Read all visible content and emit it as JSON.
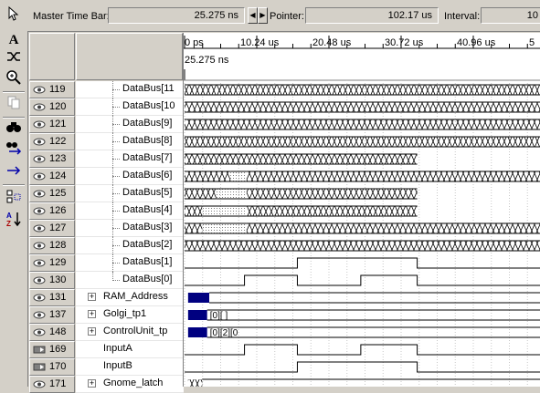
{
  "topbar": {
    "master_label": "Master Time Bar:",
    "master_value": "25.275 ns",
    "pointer_label": "Pointer:",
    "pointer_value": "102.17 us",
    "interval_label": "Interval:",
    "interval_value": "10"
  },
  "timeline": {
    "ticks": [
      "0 ps",
      "10.24 us",
      "20.48 us",
      "30.72 us",
      "40.96 us",
      "5"
    ],
    "cursor_label": "25.275 ns"
  },
  "toolbar": {
    "tools": [
      "select-arrow-icon",
      "text-tool-icon",
      "waveform-edit-icon",
      "zoom-icon",
      "copy-icon",
      "find-icon",
      "find-next-icon",
      "goto-icon",
      "group-icon",
      "sort-icon"
    ]
  },
  "rows": [
    {
      "id": "119",
      "name": "DataBus[11",
      "type": "child",
      "dir": "out",
      "wave": "bus"
    },
    {
      "id": "120",
      "name": "DataBus[10",
      "type": "child",
      "dir": "out",
      "wave": "bus"
    },
    {
      "id": "121",
      "name": "DataBus[9]",
      "type": "child",
      "dir": "out",
      "wave": "bus"
    },
    {
      "id": "122",
      "name": "DataBus[8]",
      "type": "child",
      "dir": "out",
      "wave": "bus"
    },
    {
      "id": "123",
      "name": "DataBus[7]",
      "type": "child",
      "dir": "out",
      "wave": "bus7"
    },
    {
      "id": "124",
      "name": "DataBus[6]",
      "type": "child",
      "dir": "out",
      "wave": "bus6"
    },
    {
      "id": "125",
      "name": "DataBus[5]",
      "type": "child",
      "dir": "out",
      "wave": "bus5"
    },
    {
      "id": "126",
      "name": "DataBus[4]",
      "type": "child",
      "dir": "out",
      "wave": "bus4"
    },
    {
      "id": "127",
      "name": "DataBus[3]",
      "type": "child",
      "dir": "out",
      "wave": "bus3"
    },
    {
      "id": "128",
      "name": "DataBus[2]",
      "type": "child",
      "dir": "out",
      "wave": "bus"
    },
    {
      "id": "129",
      "name": "DataBus[1]",
      "type": "child",
      "dir": "out",
      "wave": "db1"
    },
    {
      "id": "130",
      "name": "DataBus[0]",
      "type": "child",
      "dir": "out",
      "wave": "db0"
    },
    {
      "id": "131",
      "name": "RAM_Address",
      "type": "group",
      "dir": "out",
      "wave": "ram",
      "bus_values": []
    },
    {
      "id": "137",
      "name": "Golgi_tp1",
      "type": "group",
      "dir": "out",
      "wave": "golgi",
      "bus_values": [
        "[0][ ]"
      ]
    },
    {
      "id": "148",
      "name": "ControlUnit_tp",
      "type": "group",
      "dir": "out",
      "wave": "ctrl",
      "bus_values": [
        "[0][2][0"
      ]
    },
    {
      "id": "169",
      "name": "InputA",
      "type": "leaf",
      "dir": "in",
      "wave": "ina"
    },
    {
      "id": "170",
      "name": "InputB",
      "type": "leaf",
      "dir": "in",
      "wave": "inb"
    },
    {
      "id": "171",
      "name": "Gnome_latch",
      "type": "group",
      "dir": "out",
      "wave": "gnome",
      "bus_values": []
    }
  ],
  "colors": {
    "background": "#d4d0c8",
    "wave_line": "#000000",
    "bus_fill": "#000080",
    "grid_dots": "#c0c0c0"
  }
}
